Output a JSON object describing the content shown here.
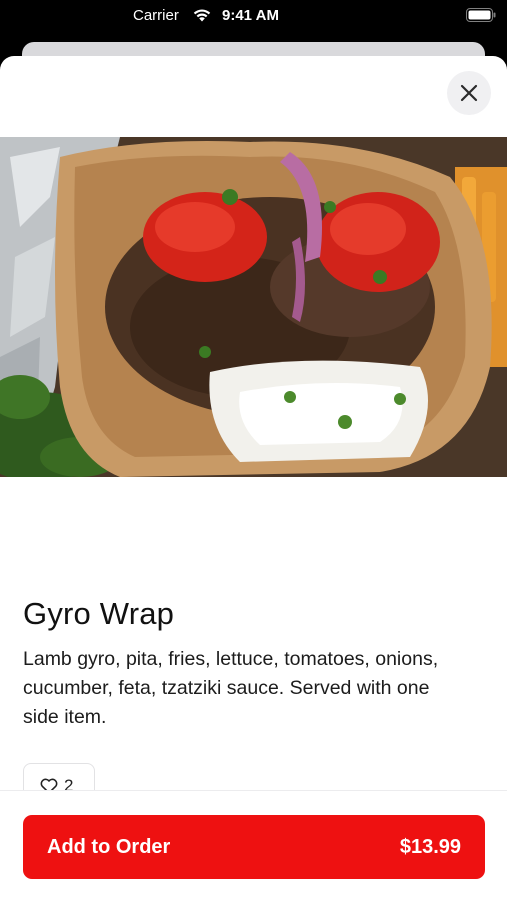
{
  "status_bar": {
    "carrier": "Carrier",
    "time": "9:41 AM"
  },
  "item": {
    "name": "Gyro Wrap",
    "description": "Lamb gyro, pita, fries, lettuce, tomatoes, onions, cucumber, feta, tzatziki sauce. Served with one side item.",
    "likes": "2"
  },
  "footer": {
    "add_label": "Add to Order",
    "price": "$13.99"
  },
  "colors": {
    "accent": "#ee1111",
    "close_bg": "#f0f0f2"
  },
  "icons": {
    "close": "close-icon",
    "like": "heart-icon",
    "wifi": "wifi-icon",
    "battery": "battery-icon"
  }
}
